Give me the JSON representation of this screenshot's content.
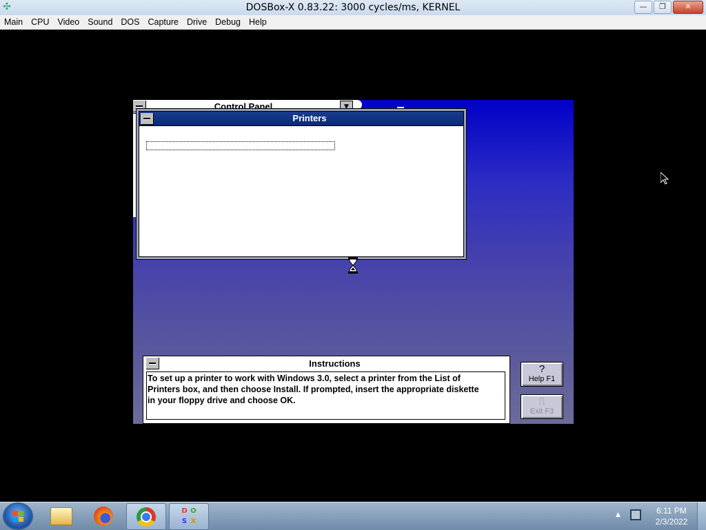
{
  "window": {
    "title": "DOSBox-X 0.83.22: 3000 cycles/ms, KERNEL",
    "minimize_glyph": "—",
    "restore_glyph": "❐",
    "close_glyph": "✕"
  },
  "menubar": {
    "items": [
      "Main",
      "CPU",
      "Video",
      "Sound",
      "DOS",
      "Capture",
      "Drive",
      "Debug",
      "Help"
    ]
  },
  "win3": {
    "control_panel": {
      "title": "Control Panel"
    },
    "printers": {
      "title": "Printers"
    },
    "instructions": {
      "title": "Instructions",
      "lines": [
        "To set up a printer to work with Windows 3.0, select a printer from the List of",
        "Printers box, and then choose Install. If prompted, insert the appropriate diskette",
        "in your floppy drive and choose OK."
      ]
    },
    "help_button": {
      "glyph": "?",
      "label": "Help  F1"
    },
    "exit_button": {
      "glyph": "⎍",
      "label": "Exit  F3"
    }
  },
  "taskbar": {
    "items": [
      "start-button",
      "explorer",
      "firefox",
      "chrome",
      "dosbox-x"
    ],
    "clock": {
      "time": "6:11 PM",
      "date": "2/3/2022"
    },
    "tray_arrow": "▲"
  },
  "colors": {
    "host_titlebar": "#c9d9ec",
    "win3_desktop_top": "#0000c8",
    "win3_active_title": "#0a2a7c",
    "close_button": "#c7432b"
  }
}
